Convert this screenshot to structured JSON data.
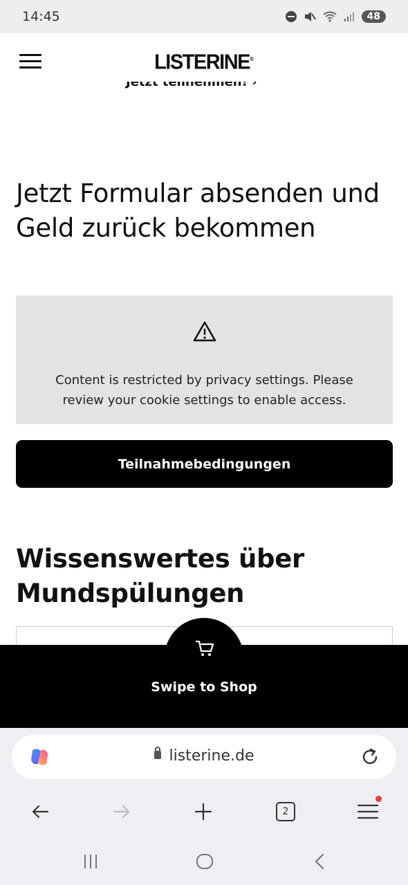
{
  "status_bar": {
    "time": "14:45",
    "battery": "48",
    "icons": [
      "do-not-disturb-icon",
      "mute-icon",
      "wifi-icon",
      "signal-icon",
      "battery-icon"
    ]
  },
  "header": {
    "logo_text": "LISTERINE",
    "logo_mark": "®",
    "clipped_link": "Jetzt teilnehmen! ›"
  },
  "main": {
    "heading": "Jetzt Formular absenden und Geld zurück bekommen",
    "privacy_notice": "Content is restricted by privacy settings. Please review your cookie settings to enable access.",
    "cta_button": "Teilnahmebedingungen",
    "section_heading": "Wissenswertes über Mundspülungen"
  },
  "shop": {
    "label": "Swipe to Shop",
    "icon": "cart-icon"
  },
  "browser": {
    "url": "listerine.de",
    "tab_count": "2",
    "colors": {
      "notification_dot": "#e04040",
      "chrome_bg": "#efeff3"
    }
  }
}
